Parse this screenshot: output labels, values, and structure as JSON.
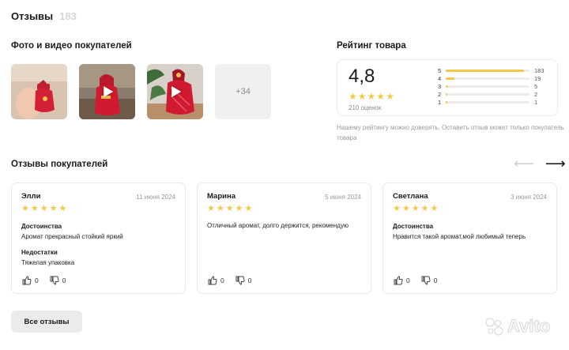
{
  "header": {
    "title": "Отзывы",
    "count": "183"
  },
  "photos_section": {
    "title": "Фото и видео покупателей",
    "items": [
      {
        "type": "photo"
      },
      {
        "type": "video"
      },
      {
        "type": "video"
      }
    ],
    "more_label": "+34"
  },
  "rating": {
    "title": "Рейтинг товара",
    "average": "4,8",
    "stars": 5,
    "total_label": "210 оценок",
    "rows": [
      {
        "star": "5",
        "count": "183",
        "fraction": 0.93
      },
      {
        "star": "4",
        "count": "19",
        "fraction": 0.1
      },
      {
        "star": "3",
        "count": "5",
        "fraction": 0.025
      },
      {
        "star": "2",
        "count": "2",
        "fraction": 0.012
      },
      {
        "star": "1",
        "count": "1",
        "fraction": 0.006
      }
    ],
    "bar_color": "#f2c94c",
    "note": "Нашему рейтингу можно доверять. Оставить отзыв может только покупатель товара"
  },
  "reviews_section": {
    "title": "Отзывы покупателей",
    "reviews": [
      {
        "author": "Элли",
        "date": "11 июня 2024",
        "rating": 5,
        "pros_label": "Достоинства",
        "pros": "Аромат прекрасный стойкий яркий",
        "cons_label": "Недостатки",
        "cons": "Тяжелая упаковка",
        "likes": "0",
        "dislikes": "0"
      },
      {
        "author": "Марина",
        "date": "5 июня 2024",
        "rating": 5,
        "text": "Отличный аромат, долго держится, рекомендую",
        "likes": "0",
        "dislikes": "0"
      },
      {
        "author": "Светлана",
        "date": "3 июня 2024",
        "rating": 5,
        "pros_label": "Достоинства",
        "pros": "Нравится такой аромат,мой любимый теперь",
        "likes": "0",
        "dislikes": "0"
      }
    ],
    "all_button": "Все отзывы"
  },
  "watermark": {
    "text": "Avito"
  },
  "colors": {
    "star": "#f2c94c",
    "button_bg": "#ebebeb"
  }
}
